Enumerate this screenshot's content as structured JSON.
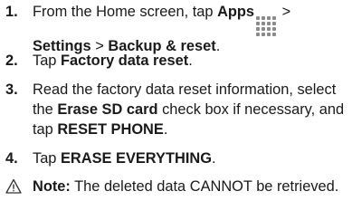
{
  "steps": [
    {
      "number": "1.",
      "parts": [
        "From the Home screen, tap ",
        "Apps",
        " > ",
        "Settings",
        " > ",
        "Backup & reset",
        "."
      ]
    },
    {
      "number": "2.",
      "parts": [
        "Tap ",
        "Factory data reset",
        "."
      ]
    },
    {
      "number": "3.",
      "parts": [
        "Read the factory data reset information, select the ",
        "Erase SD card",
        " check box if necessary, and tap ",
        "RESET PHONE",
        "."
      ]
    },
    {
      "number": "4.",
      "parts": [
        "Tap ",
        "ERASE EVERYTHING",
        "."
      ]
    }
  ],
  "note": {
    "label": "Note:",
    "text": " The deleted data CANNOT be retrieved.",
    "icon": "warning-triangle-icon"
  }
}
